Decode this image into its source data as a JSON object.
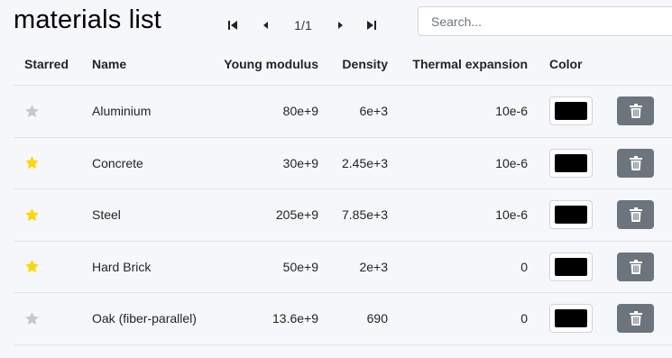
{
  "title": "materials list",
  "pager": {
    "indicator": "1/1"
  },
  "search": {
    "placeholder": "Search...",
    "value": ""
  },
  "columns": {
    "starred": "Starred",
    "name": "Name",
    "young": "Young modulus",
    "density": "Density",
    "thermal": "Thermal expansion",
    "color": "Color"
  },
  "colors": {
    "star_on": "#ffd500",
    "star_off": "#c5c8cc",
    "delete_bg": "#6c757d"
  },
  "rows": [
    {
      "starred": false,
      "name": "Aluminium",
      "young": "80e+9",
      "density": "6e+3",
      "thermal": "10e-6",
      "color": "#000000"
    },
    {
      "starred": true,
      "name": "Concrete",
      "young": "30e+9",
      "density": "2.45e+3",
      "thermal": "10e-6",
      "color": "#000000"
    },
    {
      "starred": true,
      "name": "Steel",
      "young": "205e+9",
      "density": "7.85e+3",
      "thermal": "10e-6",
      "color": "#000000"
    },
    {
      "starred": true,
      "name": "Hard Brick",
      "young": "50e+9",
      "density": "2e+3",
      "thermal": "0",
      "color": "#000000"
    },
    {
      "starred": false,
      "name": "Oak (fiber-parallel)",
      "young": "13.6e+9",
      "density": "690",
      "thermal": "0",
      "color": "#000000"
    }
  ]
}
